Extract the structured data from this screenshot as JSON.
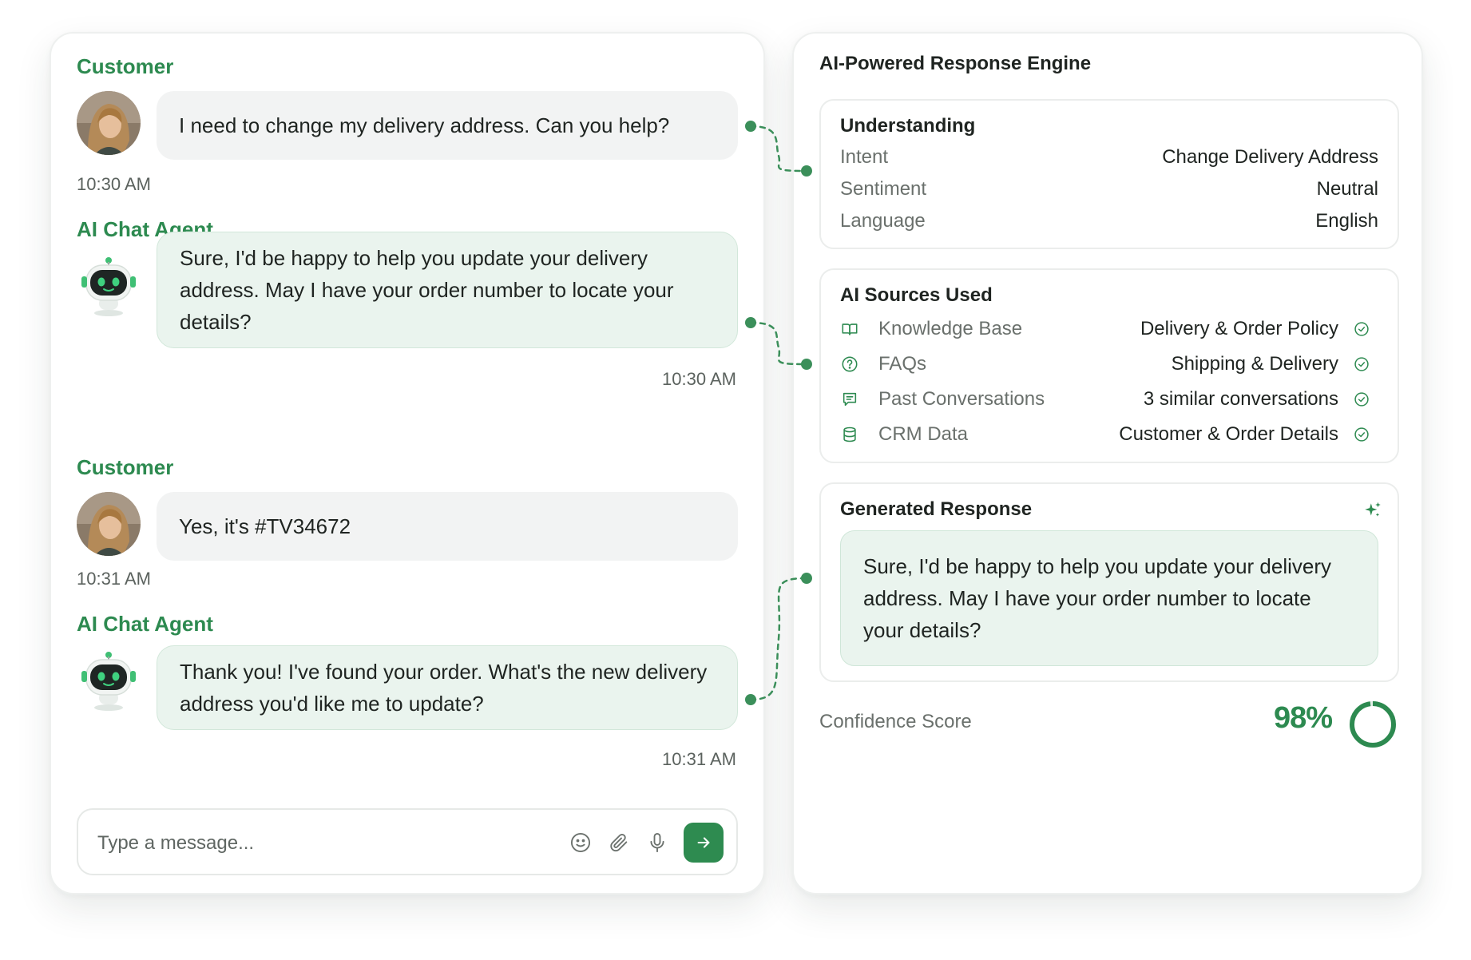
{
  "chat": {
    "messages": [
      {
        "sender": "Customer",
        "text": "I need to change my delivery address. Can you help?",
        "time": "10:30 AM"
      },
      {
        "sender": "AI Chat Agent",
        "text": "Sure, I'd be happy to help you update your delivery address. May I have your order number to locate your details?",
        "time": "10:30 AM"
      },
      {
        "sender": "Customer",
        "text": "Yes, it's #TV34672",
        "time": "10:31 AM"
      },
      {
        "sender": "AI Chat Agent",
        "text": "Thank you! I've found your order. What's the new delivery address you'd like me to update?",
        "time": "10:31 AM"
      }
    ],
    "composer": {
      "placeholder": "Type a message...",
      "icons": [
        "smile-icon",
        "paperclip-icon",
        "microphone-icon",
        "arrow-right-icon"
      ]
    }
  },
  "engine": {
    "title": "AI-Powered Response Engine",
    "understanding": {
      "title": "Understanding",
      "rows": [
        {
          "key": "Intent",
          "value": "Change Delivery Address"
        },
        {
          "key": "Sentiment",
          "value": "Neutral"
        },
        {
          "key": "Language",
          "value": "English"
        }
      ]
    },
    "sources": {
      "title": "AI Sources Used",
      "rows": [
        {
          "icon": "book-icon",
          "name": "Knowledge Base",
          "value": "Delivery & Order Policy"
        },
        {
          "icon": "question-circle-icon",
          "name": "FAQs",
          "value": "Shipping & Delivery"
        },
        {
          "icon": "chat-lines-icon",
          "name": "Past Conversations",
          "value": "3 similar conversations"
        },
        {
          "icon": "database-icon",
          "name": "CRM Data",
          "value": "Customer & Order Details"
        }
      ]
    },
    "generated": {
      "title": "Generated Response",
      "text": "Sure, I'd be happy to help you update your delivery address. May I have your order number to locate your details?",
      "icon": "sparkle-icon"
    },
    "confidence": {
      "label": "Confidence Score",
      "value": "98%",
      "fraction": 0.98
    }
  },
  "colors": {
    "accent": "#2d8a50",
    "agent_bubble": "#eaf4ee",
    "customer_bubble": "#f2f3f3"
  }
}
